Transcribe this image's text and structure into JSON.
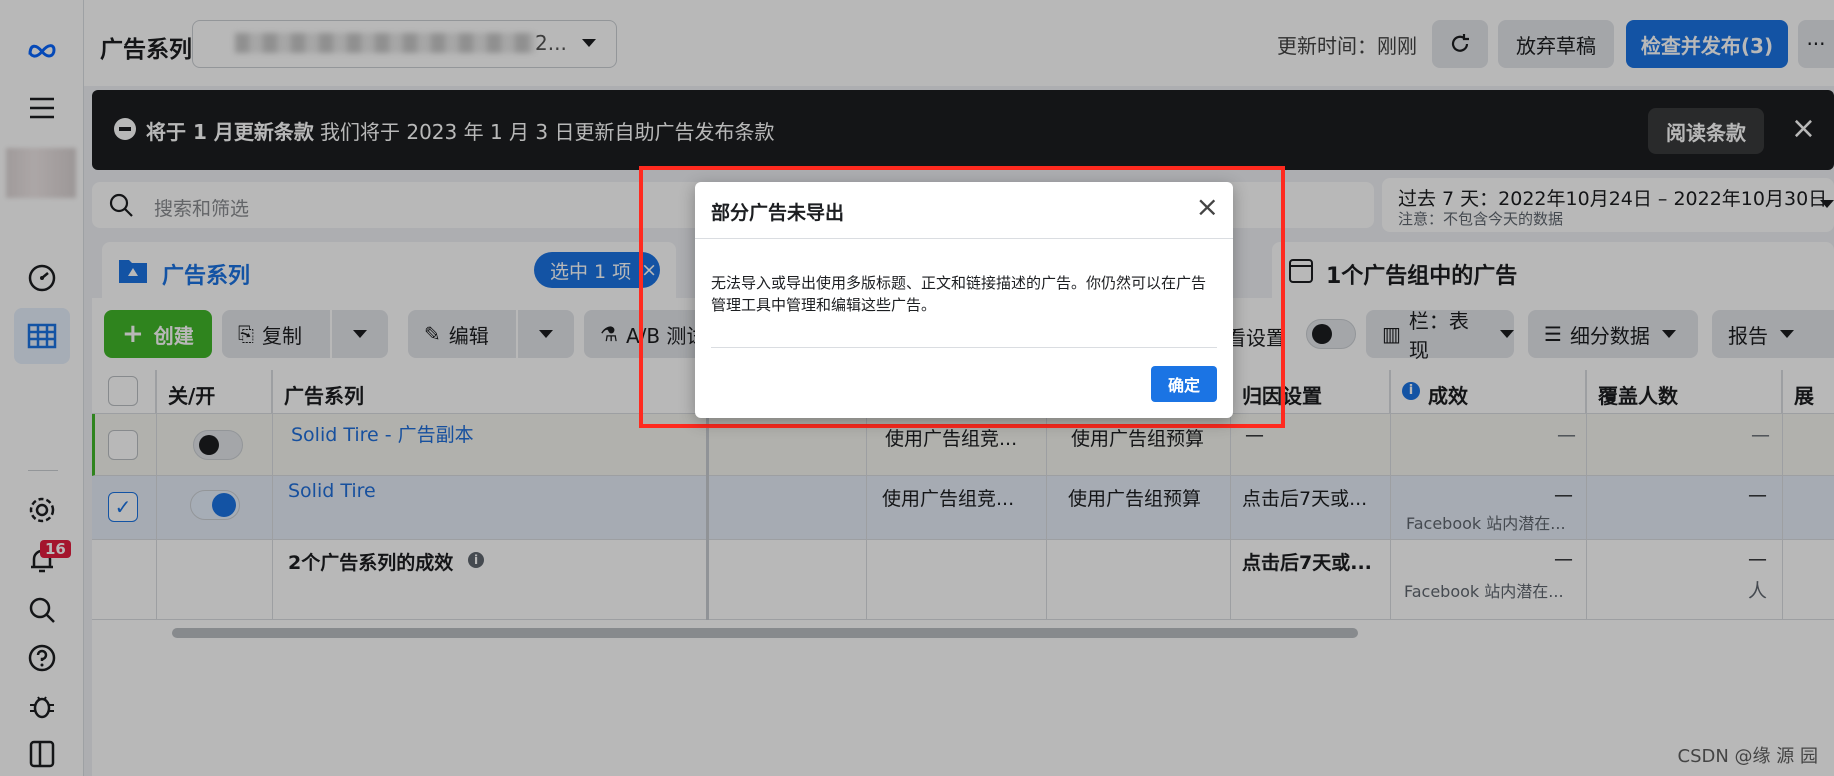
{
  "topbar": {
    "crumb": "广告系列",
    "campaign_tail": "2...",
    "updated": "更新时间：刚刚",
    "discard": "放弃草稿",
    "publish": "检查并发布(3)",
    "more": "···"
  },
  "notice": {
    "title": "将于 1 月更新条款",
    "text": "我们将于 2023 年 1 月 3 日更新自助广告发布条款",
    "read": "阅读条款",
    "close": "×"
  },
  "search": {
    "placeholder": "搜索和筛选"
  },
  "date": {
    "range": "过去 7 天：2022年10月24日 – 2022年10月30日",
    "note": "注意：不包含今天的数据"
  },
  "tabs": {
    "campaigns": "广告系列",
    "selected": "选中 1 项",
    "ads": "1个广告组中的广告"
  },
  "toolbar": {
    "create": "创建",
    "copy": "复制",
    "edit": "编辑",
    "ab": "A/B 测试",
    "view_settings": "看设置",
    "columns": "栏：表现",
    "breakdown": "细分数据",
    "report": "报告"
  },
  "table": {
    "headers": {
      "onoff": "关/开",
      "campaign": "广告系列",
      "attribution": "归因设置",
      "results": "成效",
      "reach": "覆盖人数",
      "impressions": "展示"
    },
    "rows": [
      {
        "name": "Solid Tire - 广告副本",
        "bid": "使用广告组竞...",
        "budget": "使用广告组预算",
        "attr": "—",
        "results": "—",
        "reach": "—"
      },
      {
        "name": "Solid Tire",
        "bid": "使用广告组竞...",
        "budget": "使用广告组预算",
        "attr": "点击后7天或...",
        "results": "—",
        "results_sub": "Facebook 站内潜在...",
        "reach": "—"
      }
    ],
    "summary": {
      "name": "2个广告系列的成效",
      "attr": "点击后7天或...",
      "results": "—",
      "results_sub": "Facebook 站内潜在...",
      "reach": "—",
      "reach_sub": "人"
    }
  },
  "rail": {
    "badge": "16"
  },
  "modal": {
    "title": "部分广告未导出",
    "body": "无法导入或导出使用多版标题、正文和链接描述的广告。你仍然可以在广告管理工具中管理和编辑这些广告。",
    "ok": "确定",
    "close": "×"
  },
  "watermark": "CSDN @缘  源  园"
}
